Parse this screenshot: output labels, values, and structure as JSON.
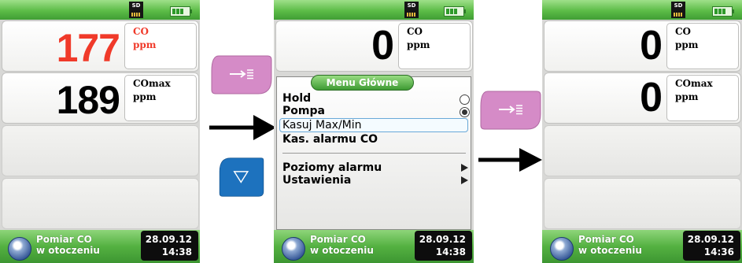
{
  "status": {
    "sd_label": "SD"
  },
  "screens": [
    {
      "fields": [
        {
          "value": "177",
          "unit1": "CO",
          "unit2": "ppm",
          "color": "#f03a2a"
        },
        {
          "value": "189",
          "unit1": "COmax",
          "unit2": "ppm",
          "color": "#000000"
        }
      ],
      "mode_line1": "Pomiar CO",
      "mode_line2": "w otoczeniu",
      "date": "28.09.12",
      "time": "14:38"
    },
    {
      "fields": [
        {
          "value": "0",
          "unit1": "CO",
          "unit2": "ppm",
          "color": "#000000"
        }
      ],
      "menu": {
        "title": "Menu Główne",
        "items": [
          "Hold",
          "Pompa",
          "Kasuj Max/Min",
          "Kas. alarmu CO",
          "Poziomy alarmu",
          "Ustawienia"
        ],
        "selected": "Kasuj Max/Min",
        "pompa_on": true
      },
      "mode_line1": "Pomiar CO",
      "mode_line2": "w otoczeniu",
      "date": "28.09.12",
      "time": "14:38"
    },
    {
      "fields": [
        {
          "value": "0",
          "unit1": "CO",
          "unit2": "ppm",
          "color": "#000000"
        },
        {
          "value": "0",
          "unit1": "COmax",
          "unit2": "ppm",
          "color": "#000000"
        }
      ],
      "mode_line1": "Pomiar CO",
      "mode_line2": "w otoczeniu",
      "date": "28.09.12",
      "time": "14:36"
    }
  ],
  "keys": {
    "enter_icon": "arrow-enter-list-icon",
    "down_icon": "triangle-down-icon",
    "enter_color": "#d58bc7",
    "down_color": "#1d72be",
    "flow_arrow_icon": "right-arrow-icon"
  },
  "colors": {
    "accent_green": "#54b141",
    "alarm_red": "#f03a2a"
  }
}
